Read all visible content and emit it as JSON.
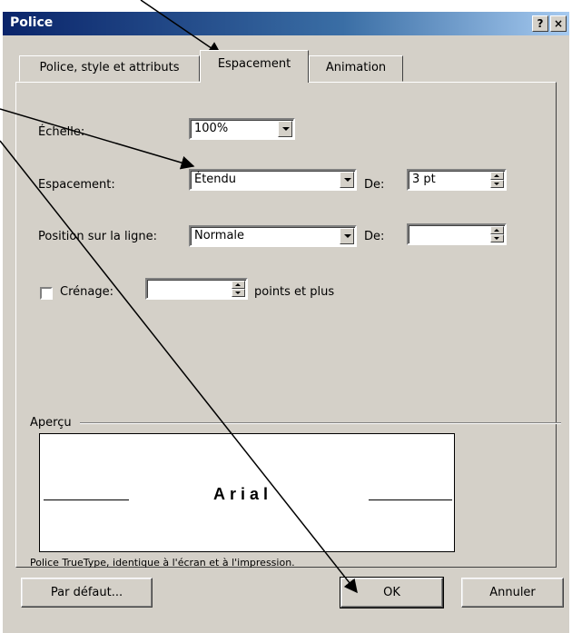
{
  "window": {
    "title": "Police",
    "help_label": "?",
    "close_label": "×"
  },
  "tabs": [
    {
      "label": "Police, style et attributs",
      "active": false
    },
    {
      "label": "Espacement",
      "active": true
    },
    {
      "label": "Animation",
      "active": false
    }
  ],
  "scale": {
    "label": "Échelle:",
    "value": "100%"
  },
  "spacing": {
    "label": "Espacement:",
    "value": "Étendu",
    "by_label": "De:",
    "by_value": "3 pt"
  },
  "position": {
    "label": "Position sur la ligne:",
    "value": "Normale",
    "by_label": "De:",
    "by_value": ""
  },
  "kerning": {
    "label": "Crénage:",
    "checked": false,
    "value": "",
    "suffix": "points et plus"
  },
  "preview": {
    "group_label": "Aperçu",
    "sample_text": "Arial",
    "note": "Police TrueType, identique à l'écran et à l'impression."
  },
  "buttons": {
    "default_label": "Par défaut...",
    "ok_label": "OK",
    "cancel_label": "Annuler"
  },
  "colors": {
    "title_bar": "#0a246a",
    "dialog_face": "#d4d0c8"
  }
}
